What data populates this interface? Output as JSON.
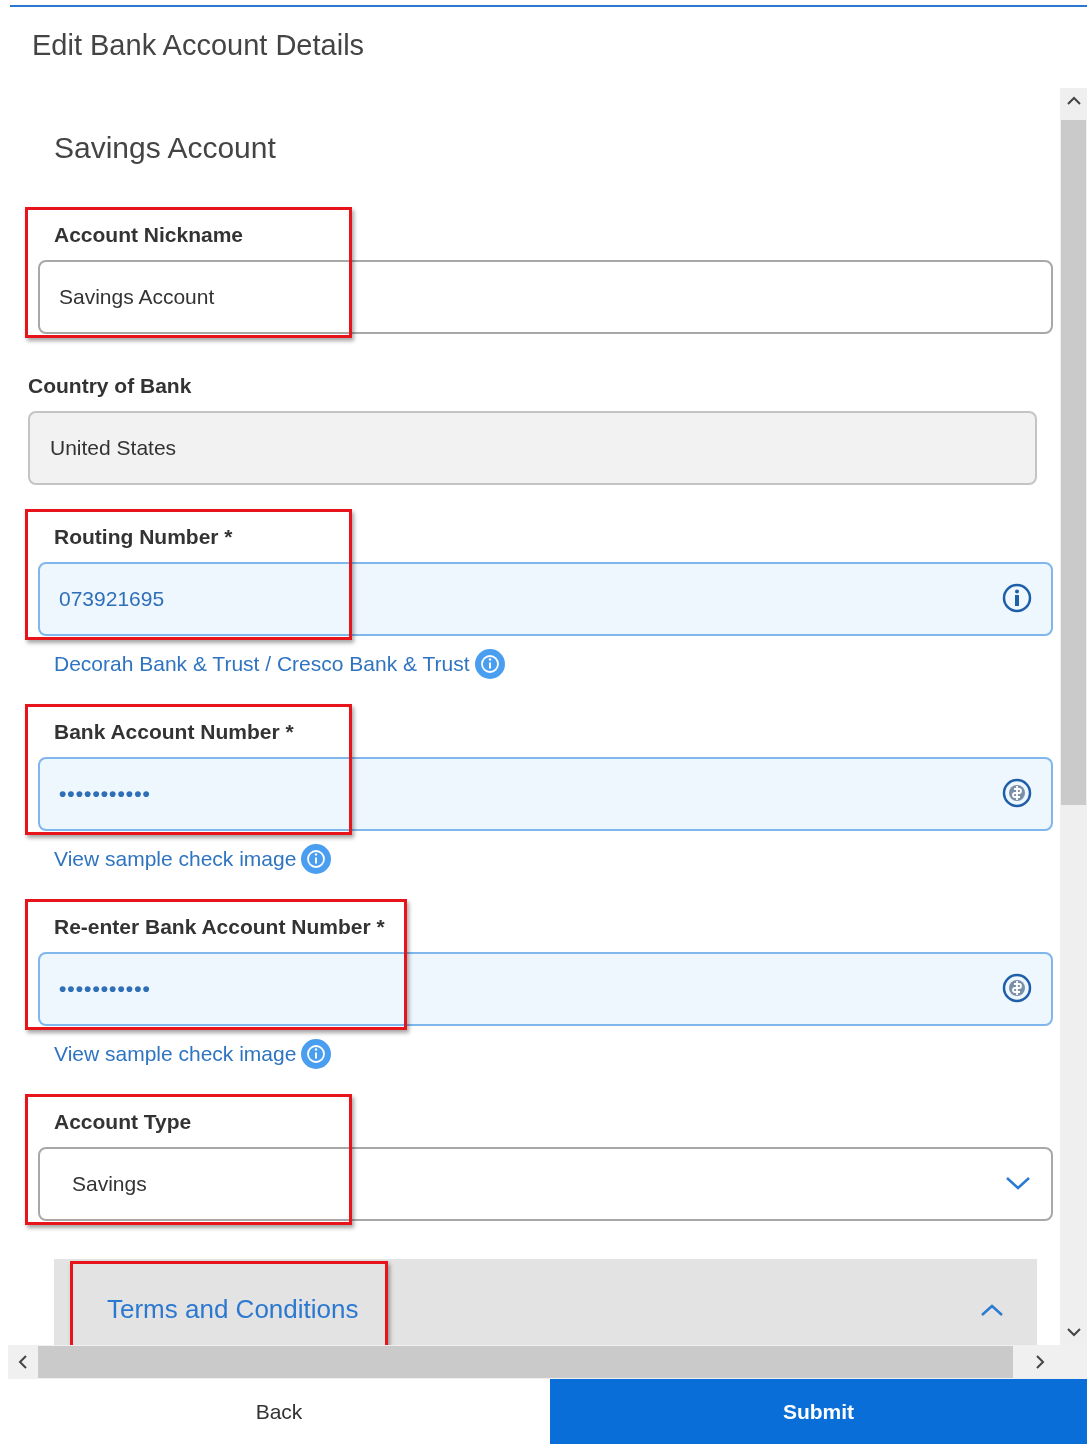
{
  "title": "Edit Bank Account Details",
  "section_title": "Savings Account",
  "fields": [
    {
      "kind": "text",
      "label": "Account Nickname",
      "value": "Savings Account",
      "disabled": false,
      "autofilled": false,
      "highlighted": true
    },
    {
      "kind": "text",
      "label": "Country of Bank",
      "value": "United States",
      "disabled": true,
      "autofilled": false,
      "highlighted": false
    },
    {
      "kind": "routing",
      "label": "Routing Number *",
      "value": "073921695",
      "disabled": false,
      "autofilled": true,
      "highlighted": true,
      "link": "Decorah Bank & Trust / Cresco Bank & Trust"
    },
    {
      "kind": "masked",
      "label": "Bank Account Number *",
      "value": "•••••••••••",
      "disabled": false,
      "autofilled": true,
      "highlighted": true,
      "link": "View sample check image"
    },
    {
      "kind": "masked",
      "label": "Re-enter Bank Account Number *",
      "value": "•••••••••••",
      "disabled": false,
      "autofilled": true,
      "highlighted": true,
      "link": "View sample check image"
    },
    {
      "kind": "select",
      "label": "Account Type",
      "value": "Savings",
      "disabled": false,
      "autofilled": false,
      "highlighted": true
    }
  ],
  "terms": {
    "title": "Terms and Conditions",
    "expanded": true,
    "highlighted": true
  },
  "buttons": [
    {
      "label": "Back",
      "kind": "secondary"
    },
    {
      "label": "Submit",
      "kind": "primary"
    }
  ]
}
